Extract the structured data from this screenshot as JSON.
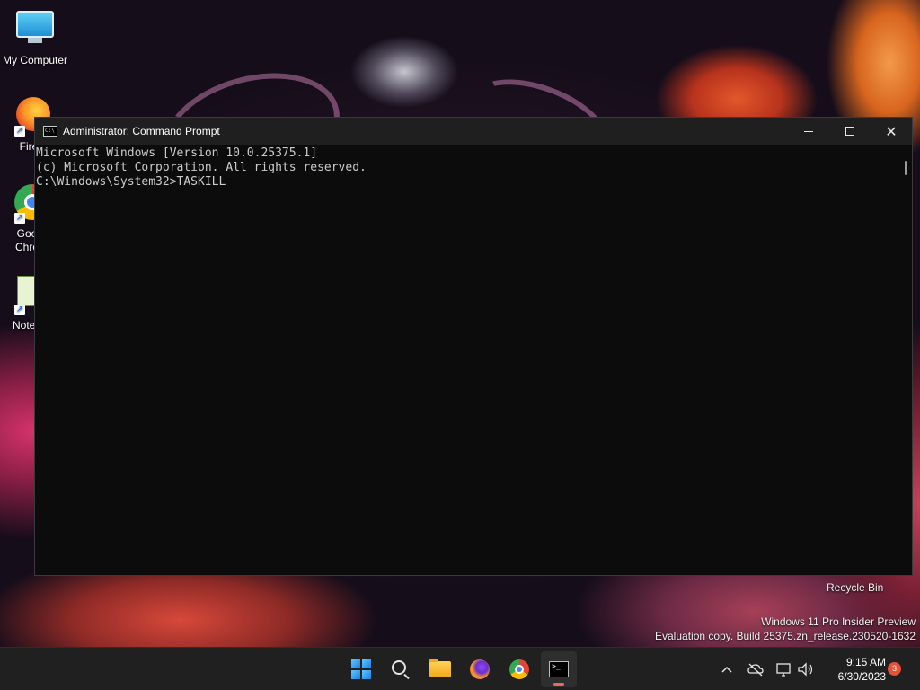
{
  "desktop": {
    "icons": [
      {
        "label": "My Computer"
      },
      {
        "label": "Fire"
      },
      {
        "label": "Goo\nChro"
      },
      {
        "label": "Notep"
      }
    ],
    "recycle_bin_label": "Recycle Bin",
    "watermark": {
      "line1": "Windows 11 Pro Insider Preview",
      "line2": "Evaluation copy. Build 25375.zn_release.230520-1632"
    }
  },
  "window": {
    "title": "Administrator: Command Prompt",
    "controls": {
      "minimize": "—",
      "maximize": "☐",
      "close": "✕"
    },
    "console_lines": [
      "Microsoft Windows [Version 10.0.25375.1]",
      "(c) Microsoft Corporation. All rights reserved.",
      "",
      "C:\\Windows\\System32>TASKILL"
    ]
  },
  "taskbar": {
    "apps": [
      {
        "name": "start",
        "icon": "windows-logo-icon"
      },
      {
        "name": "search",
        "icon": "search-icon"
      },
      {
        "name": "file-explorer",
        "icon": "folder-icon"
      },
      {
        "name": "firefox",
        "icon": "firefox-icon"
      },
      {
        "name": "chrome",
        "icon": "chrome-icon"
      },
      {
        "name": "command-prompt",
        "icon": "terminal-icon",
        "active": true
      }
    ],
    "tray": {
      "chevron": "^",
      "clock_time": "9:15 AM",
      "clock_date": "6/30/2023",
      "notification_count": "3"
    }
  }
}
